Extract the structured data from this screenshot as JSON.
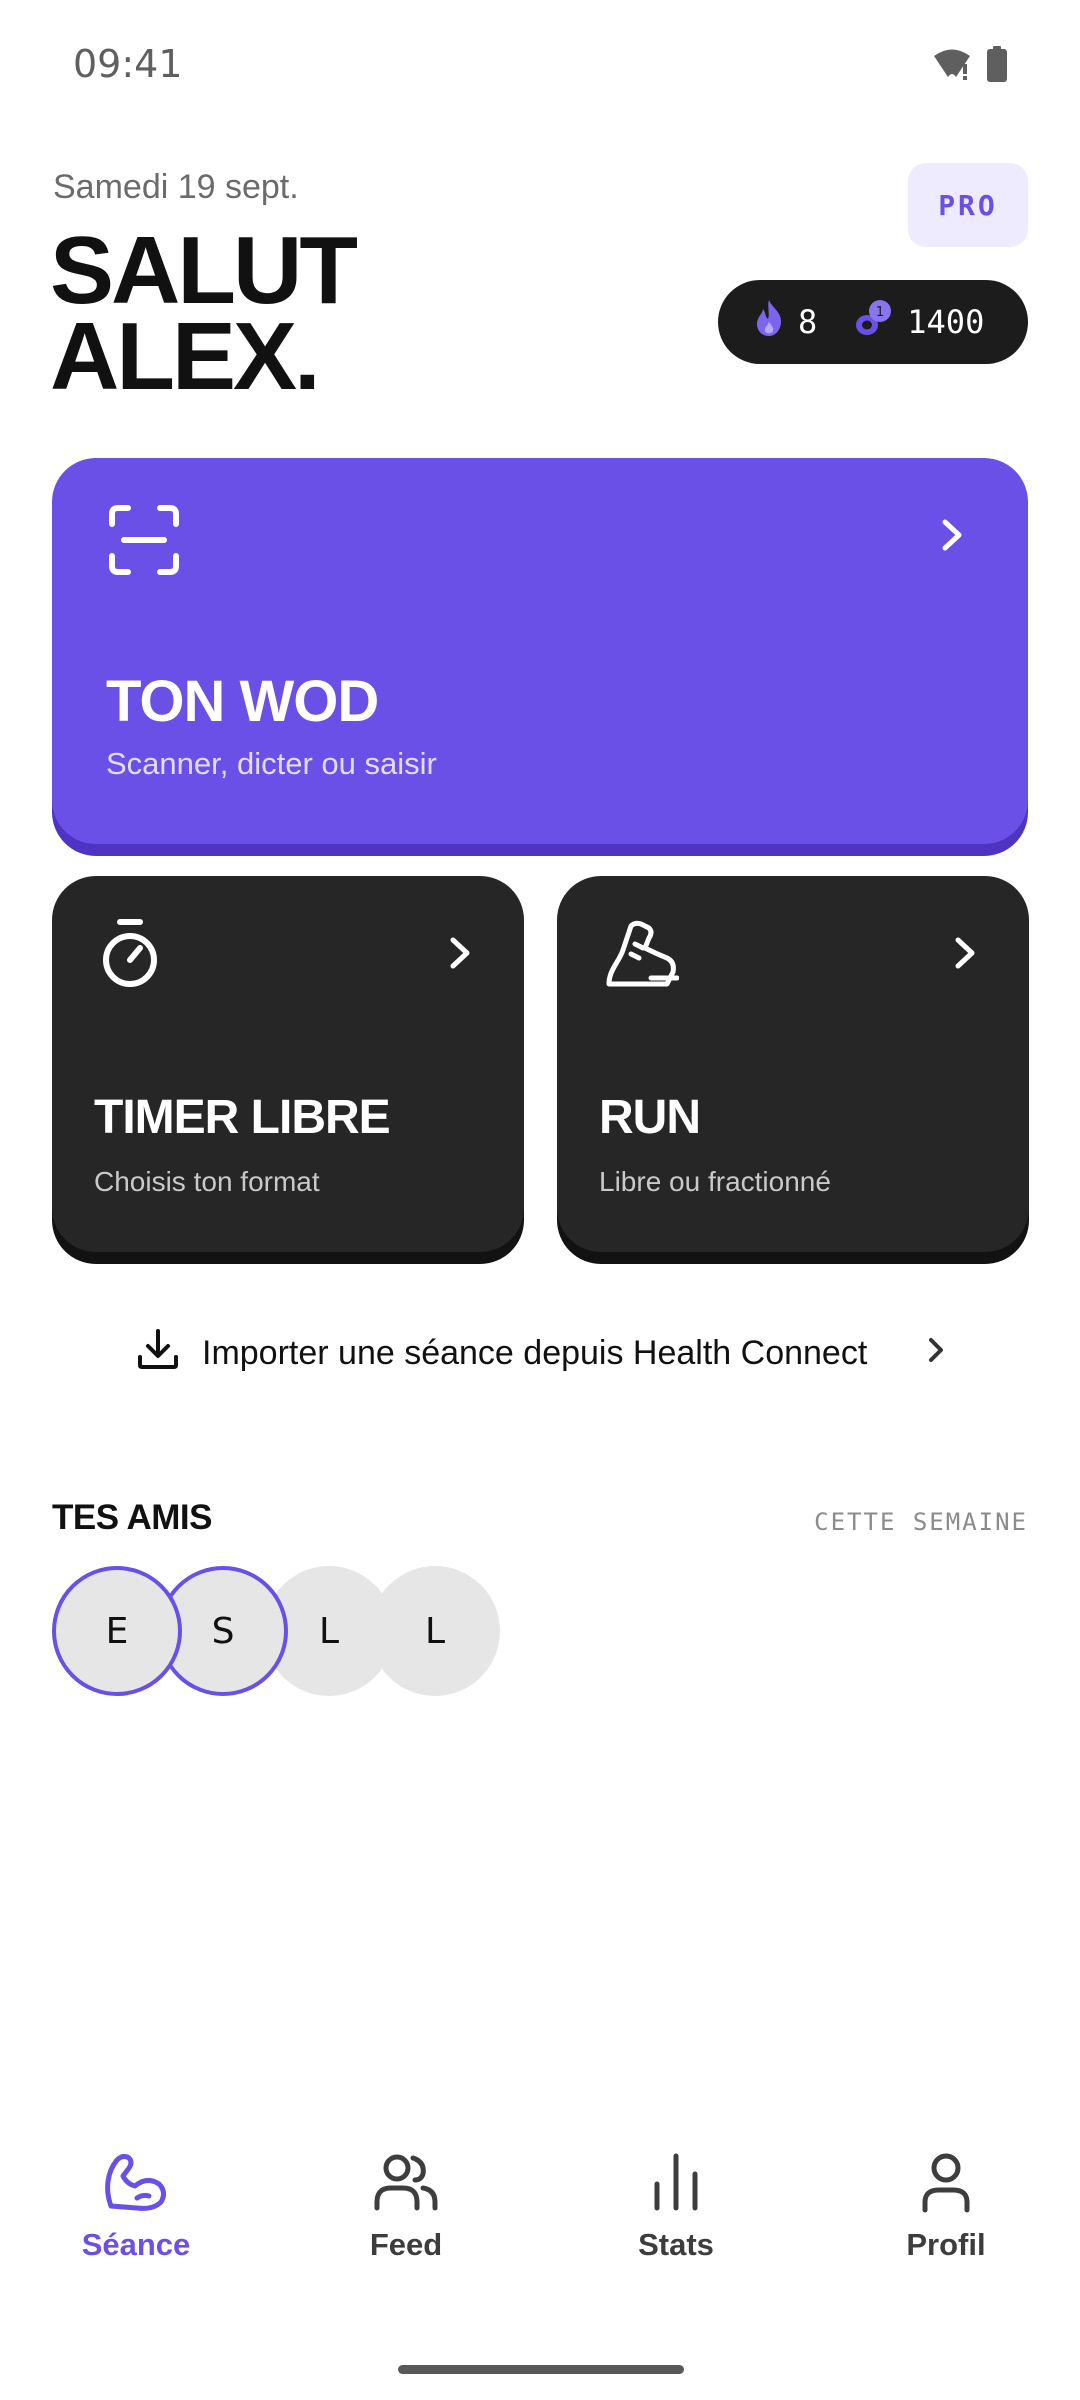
{
  "status_bar": {
    "time": "09:41",
    "icons": [
      "wifi-alert-icon",
      "battery-icon"
    ]
  },
  "header": {
    "date": "Samedi 19 sept.",
    "greeting_line1": "SALUT",
    "greeting_line2": "ALEX.",
    "pro_label": "PRO",
    "streak": {
      "icon": "flame-icon",
      "value": "8"
    },
    "coins": {
      "icon": "coins-icon",
      "value": "1400"
    }
  },
  "cards": {
    "wod": {
      "title": "TON WOD",
      "subtitle": "Scanner, dicter ou saisir",
      "icon": "scan-icon"
    },
    "timer": {
      "title": "TIMER LIBRE",
      "subtitle": "Choisis ton format",
      "icon": "stopwatch-icon"
    },
    "run": {
      "title": "RUN",
      "subtitle": "Libre ou fractionné",
      "icon": "running-shoe-icon"
    }
  },
  "import": {
    "label": "Importer une séance depuis Health Connect",
    "icon": "download-icon"
  },
  "friends": {
    "title": "TES AMIS",
    "period": "CETTE SEMAINE",
    "avatars": [
      {
        "initial": "E",
        "active": true
      },
      {
        "initial": "S",
        "active": true
      },
      {
        "initial": "L",
        "active": false
      },
      {
        "initial": "L",
        "active": false
      }
    ]
  },
  "nav": {
    "items": [
      {
        "label": "Séance",
        "icon": "flexed-arm-icon",
        "active": true
      },
      {
        "label": "Feed",
        "icon": "users-icon",
        "active": false
      },
      {
        "label": "Stats",
        "icon": "bar-chart-icon",
        "active": false
      },
      {
        "label": "Profil",
        "icon": "user-icon",
        "active": false
      }
    ]
  },
  "colors": {
    "accent": "#6a50e6",
    "accent_dark": "#4f34c4",
    "card_dark": "#262626",
    "pill": "#1c1c1c",
    "pro_bg": "#eeeaff"
  }
}
